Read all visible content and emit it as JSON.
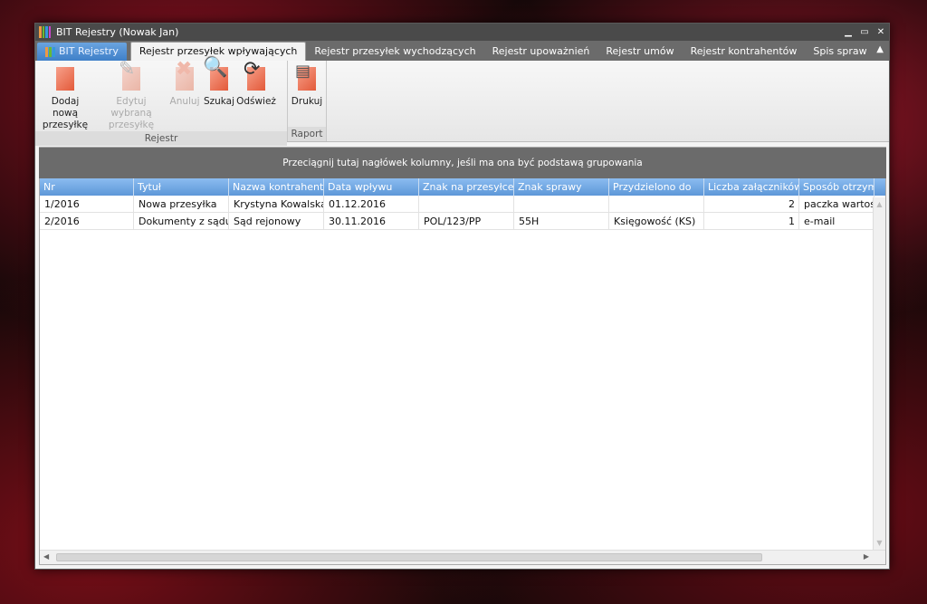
{
  "window": {
    "title": "BIT Rejestry (Nowak Jan)"
  },
  "tabs": {
    "app": "BIT Rejestry",
    "items": [
      "Rejestr przesyłek wpływających",
      "Rejestr przesyłek wychodzących",
      "Rejestr upoważnień",
      "Rejestr umów",
      "Rejestr kontrahentów",
      "Spis spraw"
    ]
  },
  "ribbon": {
    "rejestr": {
      "label": "Rejestr",
      "add_1": "Dodaj nową",
      "add_2": "przesyłkę",
      "edit_1": "Edytuj wybraną",
      "edit_2": "przesyłkę",
      "cancel": "Anuluj",
      "search": "Szukaj",
      "refresh": "Odśwież"
    },
    "raport": {
      "label": "Raport",
      "print": "Drukuj"
    }
  },
  "grid": {
    "group_hint": "Przeciągnij tutaj nagłówek kolumny, jeśli ma ona być podstawą grupowania",
    "columns": [
      "Nr",
      "Tytuł",
      "Nazwa kontrahenta",
      "Data wpływu",
      "Znak na przesyłce",
      "Znak sprawy",
      "Przydzielono do",
      "Liczba załączników",
      "Sposób otrzymania"
    ],
    "rows": [
      [
        "1/2016",
        "Nowa przesyłka",
        "Krystyna Kowalska",
        "01.12.2016",
        "",
        "",
        "",
        "2",
        "paczka wartościowa"
      ],
      [
        "2/2016",
        "Dokumenty z sądu",
        "Sąd rejonowy",
        "30.11.2016",
        "POL/123/PP",
        "55H",
        "Księgowość (KS)",
        "1",
        "e-mail"
      ]
    ]
  },
  "colors": {
    "header": "#5d97d8",
    "accent": "#e35a3a",
    "titlebar": "#4a4a4a"
  }
}
